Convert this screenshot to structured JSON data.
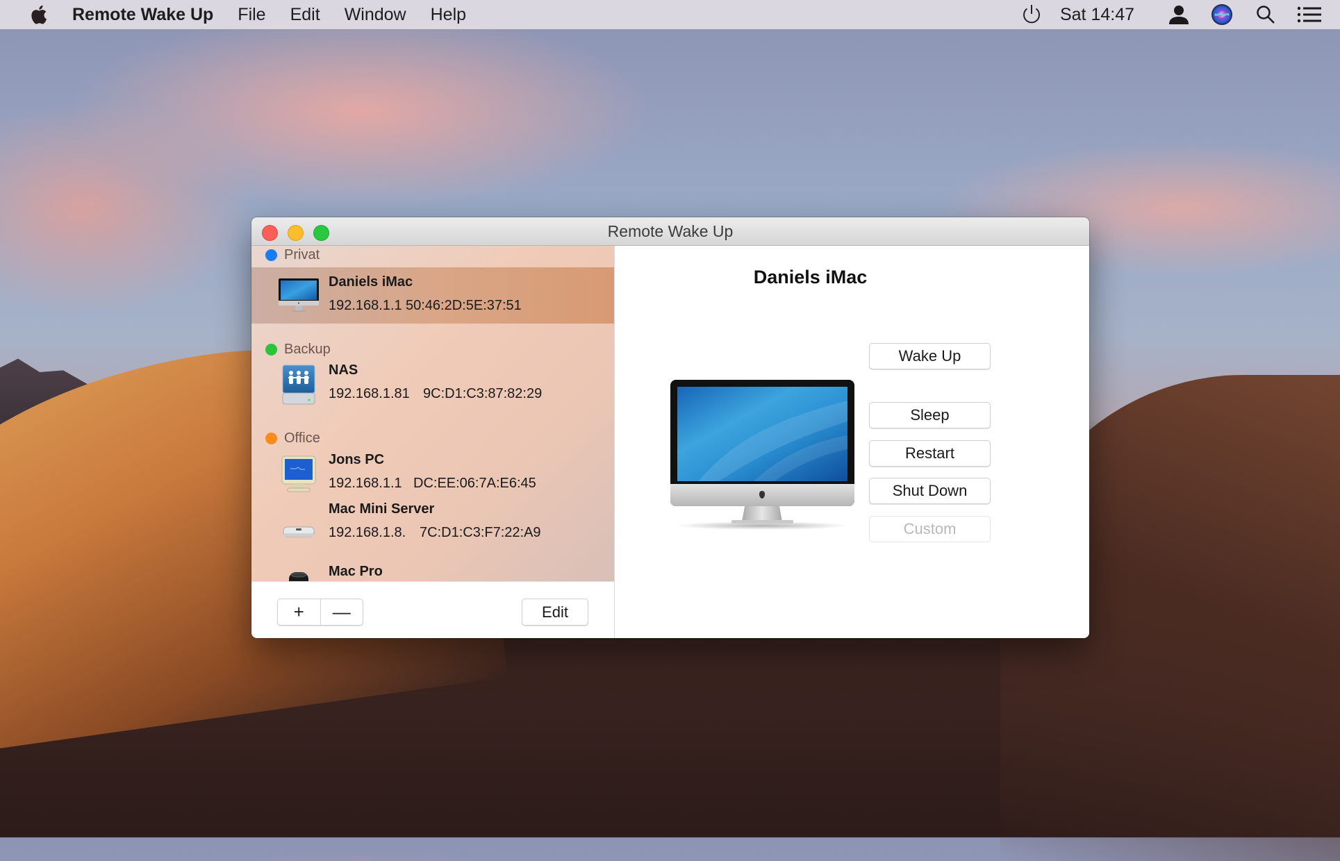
{
  "menubar": {
    "apple_icon": "apple-logo-icon",
    "app_name": "Remote Wake Up",
    "menus": [
      "File",
      "Edit",
      "Window",
      "Help"
    ],
    "clock": "Sat 14:47",
    "status_icons": [
      "power-icon",
      "user-icon",
      "siri-icon",
      "spotlight-search-icon",
      "notification-center-icon"
    ]
  },
  "window": {
    "title": "Remote Wake Up",
    "traffic_lights": {
      "close": "#fc5f57",
      "minimize": "#fdbc2e",
      "zoom": "#29c840"
    }
  },
  "sidebar": {
    "groups": [
      {
        "name": "Privat",
        "color": "#1a7cf5",
        "devices": [
          {
            "name": "Daniels iMac",
            "ip": "192.168.1.1",
            "mac": "50:46:2D:5E:37:51",
            "icon": "imac-icon",
            "selected": true
          }
        ]
      },
      {
        "name": "Backup",
        "color": "#2ac33b",
        "devices": [
          {
            "name": "NAS",
            "ip": "192.168.1.81",
            "mac": "9C:D1:C3:87:82:29",
            "icon": "nas-drive-icon",
            "selected": false
          }
        ]
      },
      {
        "name": "Office",
        "color": "#fb8c1c",
        "devices": [
          {
            "name": "Jons PC",
            "ip": "192.168.1.1",
            "mac": "DC:EE:06:7A:E6:45",
            "icon": "pc-monitor-icon",
            "selected": false
          },
          {
            "name": "Mac Mini Server",
            "ip": "192.168.1.8.",
            "mac": "7C:D1:C3:F7:22:A9",
            "icon": "mac-mini-icon",
            "selected": false
          },
          {
            "name": "Mac Pro",
            "ip": "",
            "mac": "",
            "icon": "mac-pro-icon",
            "selected": false
          }
        ]
      }
    ],
    "footer": {
      "add_label": "+",
      "remove_label": "—",
      "edit_label": "Edit"
    }
  },
  "detail": {
    "title": "Daniels iMac",
    "image": "imac-large-icon",
    "actions": [
      {
        "label": "Wake Up",
        "enabled": true
      },
      {
        "label": "Sleep",
        "enabled": true
      },
      {
        "label": "Restart",
        "enabled": true
      },
      {
        "label": "Shut Down",
        "enabled": true
      },
      {
        "label": "Custom",
        "enabled": false
      }
    ]
  }
}
